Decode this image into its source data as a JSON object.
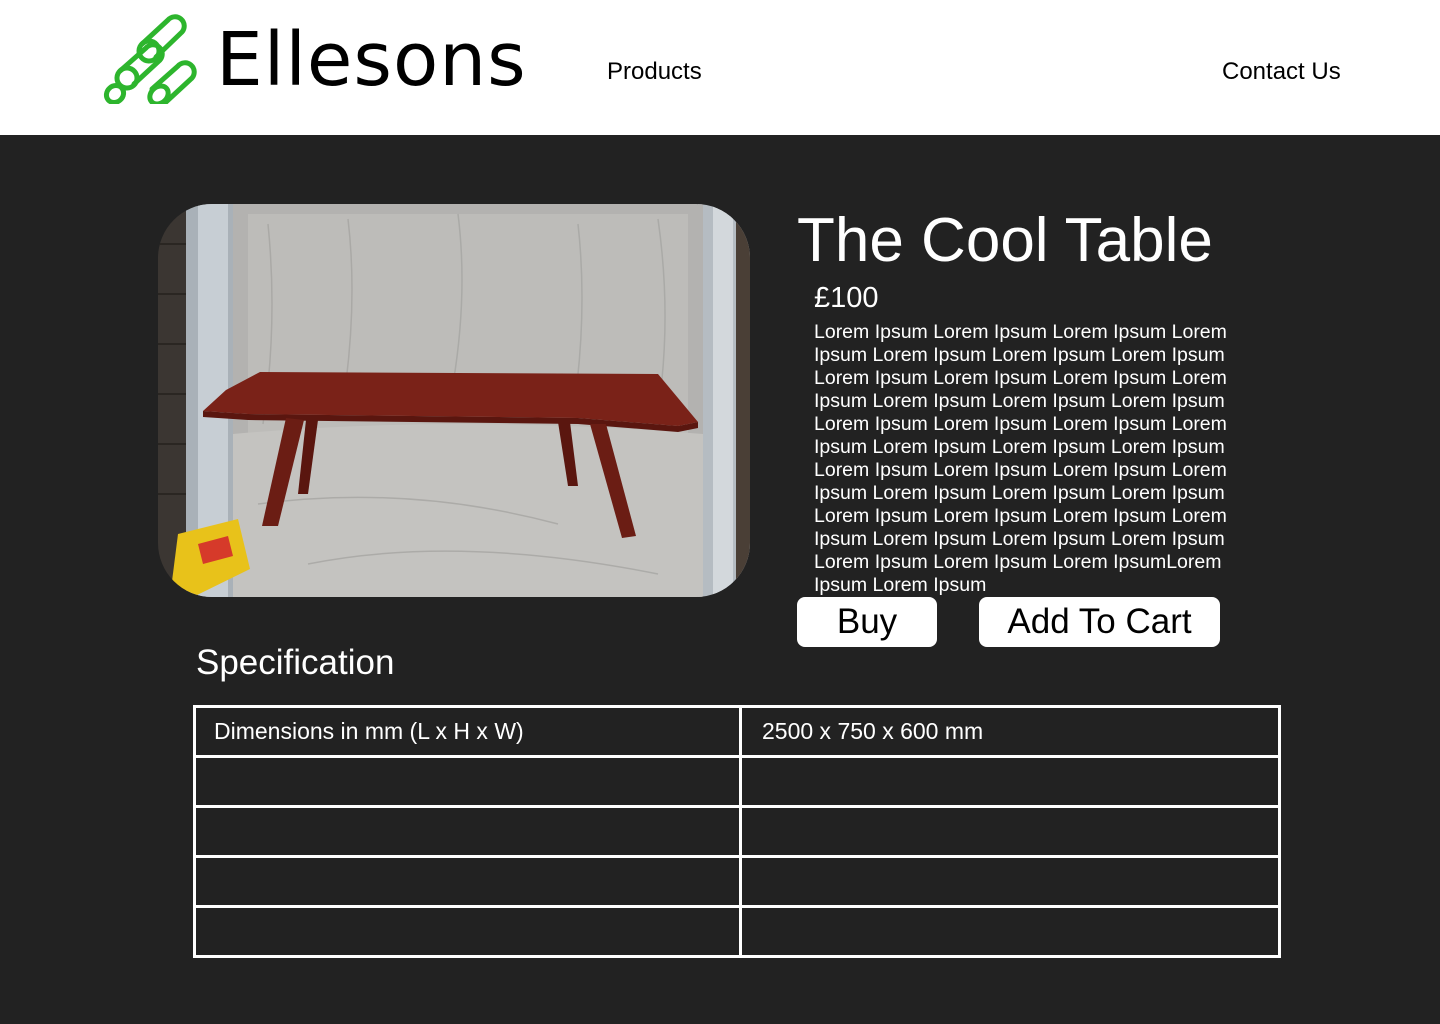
{
  "header": {
    "brand": "Ellesons",
    "logo_icon": "green-log-pile-icon",
    "nav": [
      {
        "label": "Products"
      },
      {
        "label": "Contact Us"
      }
    ]
  },
  "product": {
    "title": "The Cool Table",
    "price": "£100",
    "description": "Lorem Ipsum Lorem Ipsum Lorem Ipsum Lorem Ipsum Lorem Ipsum Lorem Ipsum Lorem Ipsum Lorem Ipsum Lorem Ipsum Lorem Ipsum Lorem Ipsum Lorem Ipsum Lorem Ipsum Lorem Ipsum Lorem Ipsum Lorem Ipsum Lorem Ipsum Lorem Ipsum Lorem Ipsum Lorem Ipsum Lorem Ipsum Lorem Ipsum Lorem Ipsum Lorem Ipsum Lorem Ipsum Lorem Ipsum Lorem Ipsum Lorem Ipsum Lorem Ipsum Lorem Ipsum Lorem Ipsum Lorem Ipsum Lorem Ipsum Lorem Ipsum Lorem Ipsum Lorem Ipsum Lorem Ipsum Lorem IpsumLorem Ipsum Lorem Ipsum",
    "buy_label": "Buy",
    "cart_label": "Add To Cart"
  },
  "specification": {
    "title": "Specification",
    "rows": [
      {
        "label": "Dimensions in mm (L x H x W)",
        "value": "2500 x 750 x 600 mm"
      },
      {
        "label": "",
        "value": ""
      },
      {
        "label": "",
        "value": ""
      },
      {
        "label": "",
        "value": ""
      },
      {
        "label": "",
        "value": ""
      }
    ]
  },
  "colors": {
    "background": "#222222",
    "header": "#ffffff",
    "logo_green": "#2db52d",
    "table_wood": "#7a2218"
  }
}
